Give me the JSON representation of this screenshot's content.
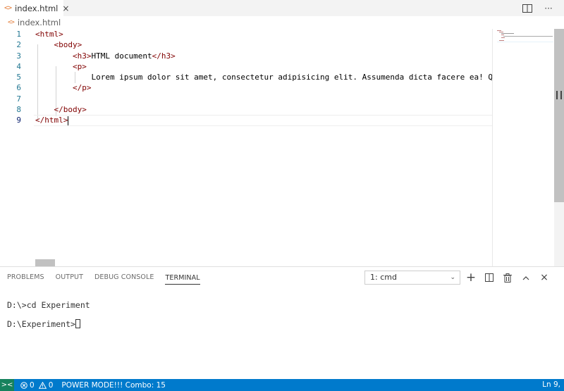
{
  "tab": {
    "icon_glyph": "<>",
    "label": "index.html",
    "close_glyph": "×"
  },
  "tab_actions": {
    "split_editor": "split-editor",
    "more": "···"
  },
  "breadcrumb": {
    "icon_glyph": "<>",
    "label": "index.html"
  },
  "editor": {
    "line_numbers": [
      "1",
      "2",
      "3",
      "4",
      "5",
      "6",
      "7",
      "8",
      "9"
    ],
    "lines": [
      {
        "indent": "",
        "parts": [
          {
            "cls": "tag",
            "text": "<html>"
          }
        ]
      },
      {
        "indent": "    ",
        "parts": [
          {
            "cls": "tag",
            "text": "<body>"
          }
        ]
      },
      {
        "indent": "        ",
        "parts": [
          {
            "cls": "tag",
            "text": "<h3>"
          },
          {
            "cls": "txt",
            "text": "HTML document"
          },
          {
            "cls": "tag",
            "text": "</h3>"
          }
        ]
      },
      {
        "indent": "        ",
        "parts": [
          {
            "cls": "tag",
            "text": "<p>"
          }
        ]
      },
      {
        "indent": "            ",
        "parts": [
          {
            "cls": "txt",
            "text": "Lorem ipsum dolor sit amet, consectetur adipisicing elit. Assumenda dicta facere ea! Qu"
          }
        ]
      },
      {
        "indent": "        ",
        "parts": [
          {
            "cls": "tag",
            "text": "</p>"
          }
        ]
      },
      {
        "indent": "",
        "parts": []
      },
      {
        "indent": "    ",
        "parts": [
          {
            "cls": "tag",
            "text": "</body>"
          }
        ]
      },
      {
        "indent": "",
        "parts": [
          {
            "cls": "tag",
            "text": "</html>"
          }
        ]
      }
    ]
  },
  "panel": {
    "tabs": [
      "PROBLEMS",
      "OUTPUT",
      "DEBUG CONSOLE",
      "TERMINAL"
    ],
    "active_tab": "TERMINAL",
    "terminal_select": "1: cmd",
    "actions": {
      "add": "+",
      "split": "split-terminal",
      "trash": "trash",
      "maximize": "^",
      "close": "×"
    }
  },
  "terminal": {
    "lines": [
      "D:\\>cd Experiment",
      "D:\\Experiment>"
    ]
  },
  "statusbar": {
    "remote_glyph": "><",
    "errors": "0",
    "warnings": "0",
    "power_mode": "POWER MODE!!! Combo: 15",
    "position": "Ln 9,"
  },
  "colors": {
    "accent": "#007acc",
    "remote": "#16825d",
    "tag": "#800000",
    "line_number": "#237893"
  }
}
